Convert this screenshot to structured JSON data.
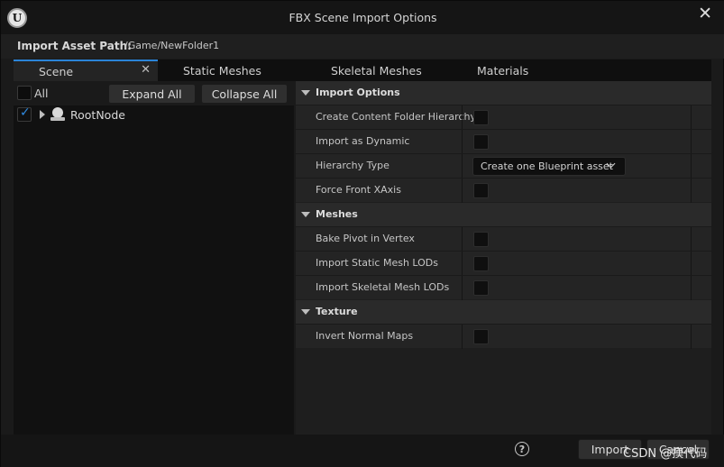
{
  "window": {
    "title": "FBX Scene Import Options",
    "close_icon": "close-icon",
    "logo": "unreal-logo-icon"
  },
  "path": {
    "label": "Import Asset Path:",
    "value": "/Game/NewFolder1"
  },
  "tabs": [
    {
      "label": "Scene",
      "active": true
    },
    {
      "label": "Static Meshes",
      "active": false
    },
    {
      "label": "Skeletal Meshes",
      "active": false
    },
    {
      "label": "Materials",
      "active": false
    }
  ],
  "scene": {
    "all_label": "All",
    "all_checked": false,
    "expand_label": "Expand All",
    "collapse_label": "Collapse All",
    "tree": [
      {
        "label": "RootNode",
        "checked": true,
        "expanded": false
      }
    ]
  },
  "categories": [
    {
      "label": "Import Options",
      "properties": [
        {
          "name": "Create Content Folder Hierarchy",
          "type": "checkbox",
          "checked": false
        },
        {
          "name": "Import as Dynamic",
          "type": "checkbox",
          "checked": false
        },
        {
          "name": "Hierarchy Type",
          "type": "dropdown",
          "value": "Create one Blueprint asset"
        },
        {
          "name": "Force Front XAxis",
          "type": "checkbox",
          "checked": false
        }
      ]
    },
    {
      "label": "Meshes",
      "properties": [
        {
          "name": "Bake Pivot in Vertex",
          "type": "checkbox",
          "checked": false
        },
        {
          "name": "Import Static Mesh LODs",
          "type": "checkbox",
          "checked": false
        },
        {
          "name": "Import Skeletal Mesh LODs",
          "type": "checkbox",
          "checked": false
        }
      ]
    },
    {
      "label": "Texture",
      "properties": [
        {
          "name": "Invert Normal Maps",
          "type": "checkbox",
          "checked": false
        }
      ]
    }
  ],
  "footer": {
    "import_label": "Import",
    "cancel_label": "Cancel",
    "help_symbol": "?",
    "watermark": "CSDN @摸代码"
  },
  "colors": {
    "accent": "#2b84d8",
    "checkmark": "#2f8ae0",
    "background": "#1a1a1a"
  }
}
